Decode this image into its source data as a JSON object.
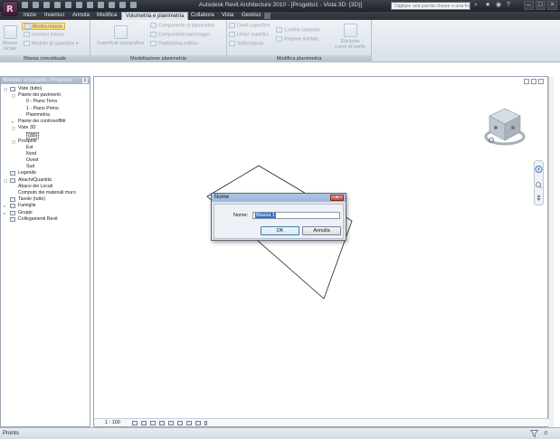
{
  "titlebar": {
    "title": "Autodesk Revit Architecture 2010 - [Progetto1 - Vista 3D: {3D}]",
    "search_placeholder": "Digitare una parola chiave o una fra"
  },
  "tabs": [
    "Inizio",
    "Inserisci",
    "Annota",
    "Modifica",
    "Volumetria e planimetria",
    "Collabora",
    "Vista",
    "Gestisci"
  ],
  "ribbon": {
    "massa_concettuale": {
      "label": "Massa concettuale",
      "massa_locale": "Massa locale",
      "mostra_massa": "Mostra massa",
      "inserisci_massa": "Inserisci massa",
      "modello_superficie": "Modello di superficie ▾"
    },
    "modellazione_planimetria": {
      "label": "Modellazione planimetria",
      "superficie_topografica": "Superficie topografica",
      "componente_planimetria": "Componente di planimetria",
      "componente_parcheggio": "Componente parcheggio",
      "piattaforma_edificio": "Piattaforma edificio"
    },
    "modifica_planimetria": {
      "label": "Modifica planimetria",
      "dividi_superficie": "Dividi superficie",
      "unisci_superfici": "Unisci superfici",
      "sottoregione": "Sottoregione",
      "confine_catastale": "Confine catastale",
      "regione_livellata": "Regione livellata",
      "etichetta": "Etichetta",
      "curve_di_livello": "curve di livello"
    }
  },
  "browser": {
    "title": "Browser di progetto - Progetto1",
    "close": "x",
    "tree": [
      {
        "label": "Viste (tutto)",
        "level": 0,
        "exp": "▢",
        "icon": "views-icon"
      },
      {
        "label": "Piante dei pavimenti",
        "level": 1,
        "exp": "▢",
        "icon": ""
      },
      {
        "label": "0 - Piano Terra",
        "level": 2,
        "exp": "",
        "icon": ""
      },
      {
        "label": "1 - Piano Primo",
        "level": 2,
        "exp": "",
        "icon": ""
      },
      {
        "label": "Planimetria",
        "level": 2,
        "exp": "",
        "icon": ""
      },
      {
        "label": "Piante dei controsoffitti",
        "level": 1,
        "exp": "▹",
        "icon": ""
      },
      {
        "label": "Viste 3D",
        "level": 1,
        "exp": "▢",
        "icon": ""
      },
      {
        "label": "{3D}",
        "level": 2,
        "exp": "",
        "icon": "",
        "selected": true
      },
      {
        "label": "Prospetti",
        "level": 1,
        "exp": "▢",
        "icon": ""
      },
      {
        "label": "Est",
        "level": 2,
        "exp": "",
        "icon": ""
      },
      {
        "label": "Nord",
        "level": 2,
        "exp": "",
        "icon": ""
      },
      {
        "label": "Ovest",
        "level": 2,
        "exp": "",
        "icon": ""
      },
      {
        "label": "Sud",
        "level": 2,
        "exp": "",
        "icon": ""
      },
      {
        "label": "Legende",
        "level": 0,
        "exp": "",
        "icon": "legend-icon"
      },
      {
        "label": "Abachi/Quantità",
        "level": 0,
        "exp": "▢",
        "icon": "schedule-icon"
      },
      {
        "label": "Abaco dei Locali",
        "level": 1,
        "exp": "",
        "icon": ""
      },
      {
        "label": "Computo dei materiali muro",
        "level": 1,
        "exp": "",
        "icon": ""
      },
      {
        "label": "Tavole (tutto)",
        "level": 0,
        "exp": "",
        "icon": "sheet-icon"
      },
      {
        "label": "Famiglie",
        "level": 0,
        "exp": "▹",
        "icon": "family-icon"
      },
      {
        "label": "Gruppi",
        "level": 0,
        "exp": "▹",
        "icon": "group-icon"
      },
      {
        "label": "Collegamenti Revit",
        "level": 0,
        "exp": "",
        "icon": "link-icon"
      }
    ]
  },
  "view": {
    "scale": "1 : 100"
  },
  "dialog": {
    "title": "Nome",
    "close": "x",
    "name_label": "Nome:",
    "name_value": "Massa 1",
    "ok": "OK",
    "cancel": "Annulla"
  },
  "status": {
    "text": "Pronto",
    "filter_count": ":0"
  },
  "colors": {
    "titlebar": "#2a2e35",
    "ribbon": "#e3e9ef",
    "dialog_titlebar": "#a8c2e2",
    "close_button": "#c94a2e",
    "selection": "#3174c8"
  }
}
